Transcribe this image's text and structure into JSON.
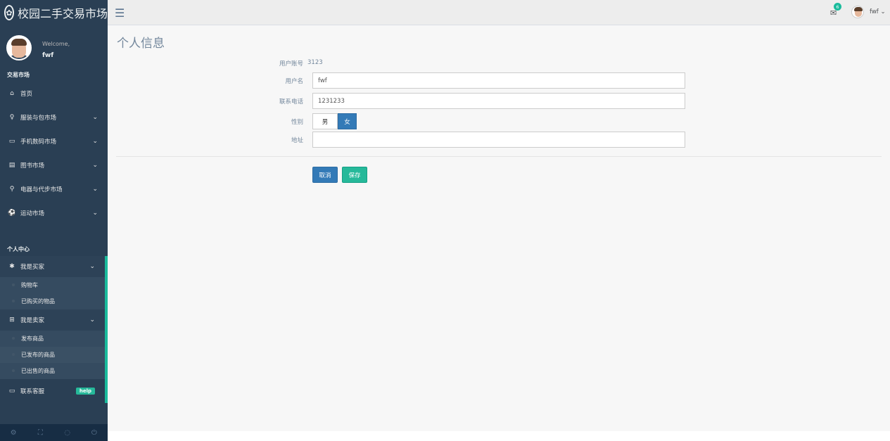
{
  "brand": {
    "icon": "paw-icon",
    "title": "校园二手交易市场"
  },
  "profile": {
    "welcome": "Welcome,",
    "name": "fwf"
  },
  "sidebar": {
    "section_market": "交易市场",
    "market_items": [
      {
        "icon": "home-icon",
        "label": "首页"
      },
      {
        "icon": "female-icon",
        "label": "服装与包市场"
      },
      {
        "icon": "laptop-icon",
        "label": "手机数码市场"
      },
      {
        "icon": "book-icon",
        "label": "图书市场"
      },
      {
        "icon": "bicycle-icon",
        "label": "电器与代步市场"
      },
      {
        "icon": "soccer-ball-icon",
        "label": "运动市场"
      }
    ],
    "section_personal": "个人中心",
    "buyer": {
      "icon": "bug-icon",
      "label": "我是买家",
      "sub": [
        "购物车",
        "已购买的物品"
      ]
    },
    "seller": {
      "icon": "sitemap-icon",
      "label": "我是卖家",
      "sub": [
        "发布商品",
        "已发布的商品",
        "已出售的商品"
      ]
    },
    "support": {
      "icon": "laptop-icon",
      "label": "联系客服",
      "badge": "help"
    }
  },
  "topbar": {
    "mail_count": "6",
    "user": "fwf"
  },
  "page": {
    "title": "个人信息",
    "account_label": "用户账号",
    "account_value": "3123",
    "username_label": "用户名",
    "username_value": "fwf",
    "phone_label": "联系电话",
    "phone_value": "1231233",
    "gender_label": "性别",
    "gender_male": "男",
    "gender_female": "女",
    "address_label": "地址",
    "address_value": "",
    "cancel_label": "取消",
    "save_label": "保存"
  },
  "colors": {
    "sidebar": "#2A3F54",
    "accent": "#1ABB9C",
    "primary": "#337AB7",
    "success": "#26B99A"
  }
}
